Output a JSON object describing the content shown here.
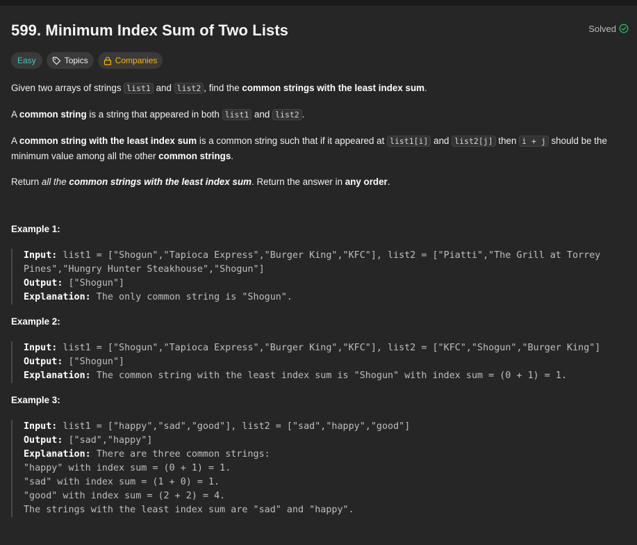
{
  "problem": {
    "title": "599. Minimum Index Sum of Two Lists",
    "status": "Solved"
  },
  "tags": {
    "difficulty": "Easy",
    "topics": "Topics",
    "companies": "Companies"
  },
  "description": {
    "p1": {
      "t1": "Given two arrays of strings ",
      "c1": "list1",
      "t2": " and ",
      "c2": "list2",
      "t3": ", find the ",
      "b1": "common strings with the least index sum",
      "t4": "."
    },
    "p2": {
      "t1": "A ",
      "b1": "common string",
      "t2": " is a string that appeared in both ",
      "c1": "list1",
      "t3": " and ",
      "c2": "list2",
      "t4": "."
    },
    "p3": {
      "t1": "A ",
      "b1": "common string with the least index sum",
      "t2": " is a common string such that if it appeared at ",
      "c1": "list1[i]",
      "t3": " and ",
      "c2": "list2[j]",
      "t4": " then ",
      "c3": "i + j",
      "t5": " should be the minimum value among all the other ",
      "b2": "common strings",
      "t6": "."
    },
    "p4": {
      "t1": "Return ",
      "i1": "all the ",
      "bi1": "common strings with the least index sum",
      "t2": ". Return the answer in ",
      "b1": "any order",
      "t3": "."
    }
  },
  "examples": [
    {
      "title": "Example 1:",
      "input_label": "Input:",
      "input_line1": " list1 = [\"Shogun\",\"Tapioca Express\",\"Burger King\",\"KFC\"], list2 = [\"Piatti\",\"The Grill at Torrey",
      "input_line2": "Pines\",\"Hungry Hunter Steakhouse\",\"Shogun\"]",
      "output_label": "Output:",
      "output": " [\"Shogun\"]",
      "explanation_label": "Explanation:",
      "explanation": " The only common string is \"Shogun\"."
    },
    {
      "title": "Example 2:",
      "input_label": "Input:",
      "input": " list1 = [\"Shogun\",\"Tapioca Express\",\"Burger King\",\"KFC\"], list2 = [\"KFC\",\"Shogun\",\"Burger King\"]",
      "output_label": "Output:",
      "output": " [\"Shogun\"]",
      "explanation_label": "Explanation:",
      "explanation": " The common string with the least index sum is \"Shogun\" with index sum = (0 + 1) = 1."
    },
    {
      "title": "Example 3:",
      "input_label": "Input:",
      "input": " list1 = [\"happy\",\"sad\",\"good\"], list2 = [\"sad\",\"happy\",\"good\"]",
      "output_label": "Output:",
      "output": " [\"sad\",\"happy\"]",
      "explanation_label": "Explanation:",
      "explanation": " There are three common strings:",
      "explanation_lines": [
        "\"happy\" with index sum = (0 + 1) = 1.",
        "\"sad\" with index sum = (1 + 0) = 1.",
        "\"good\" with index sum = (2 + 2) = 4.",
        "The strings with the least index sum are \"sad\" and \"happy\"."
      ]
    }
  ],
  "colors": {
    "background": "#262626",
    "easy": "#46c6c2",
    "companies": "#ffb700",
    "solved_check": "#2cbb5d"
  }
}
